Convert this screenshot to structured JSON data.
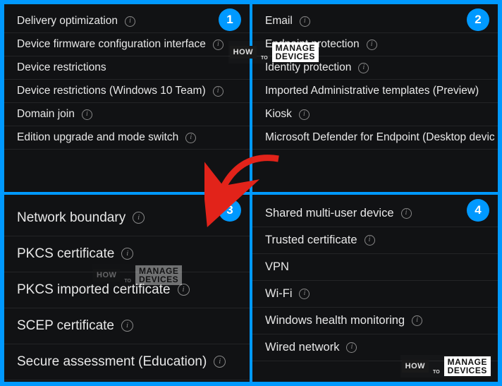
{
  "panels": {
    "p1": {
      "badge": "1",
      "items": [
        {
          "label": "Delivery optimization",
          "info": true
        },
        {
          "label": "Device firmware configuration interface",
          "info": true
        },
        {
          "label": "Device restrictions",
          "info": false
        },
        {
          "label": "Device restrictions (Windows 10 Team)",
          "info": true
        },
        {
          "label": "Domain join",
          "info": true
        },
        {
          "label": "Edition upgrade and mode switch",
          "info": true
        }
      ]
    },
    "p2": {
      "badge": "2",
      "items": [
        {
          "label": "Email",
          "info": true
        },
        {
          "label": "Endpoint protection",
          "info": true
        },
        {
          "label": "Identity protection",
          "info": true
        },
        {
          "label": "Imported Administrative templates (Preview)",
          "info": false
        },
        {
          "label": "Kiosk",
          "info": true
        },
        {
          "label": "Microsoft Defender for Endpoint (Desktop devic",
          "info": false
        }
      ]
    },
    "p3": {
      "badge": "3",
      "items": [
        {
          "label": "Network boundary",
          "info": true
        },
        {
          "label": "PKCS certificate",
          "info": true
        },
        {
          "label": "PKCS imported certificate",
          "info": true
        },
        {
          "label": "SCEP certificate",
          "info": true
        },
        {
          "label": "Secure assessment (Education)",
          "info": true
        }
      ]
    },
    "p4": {
      "badge": "4",
      "items": [
        {
          "label": "Shared multi-user device",
          "info": true
        },
        {
          "label": "Trusted certificate",
          "info": true
        },
        {
          "label": "VPN",
          "info": false
        },
        {
          "label": "Wi-Fi",
          "info": true
        },
        {
          "label": "Windows health monitoring",
          "info": true
        },
        {
          "label": "Wired network",
          "info": true
        }
      ]
    }
  },
  "watermark": {
    "how": "HOW",
    "to": "TO",
    "line1": "MANAGE",
    "line2": "DEVICES"
  }
}
